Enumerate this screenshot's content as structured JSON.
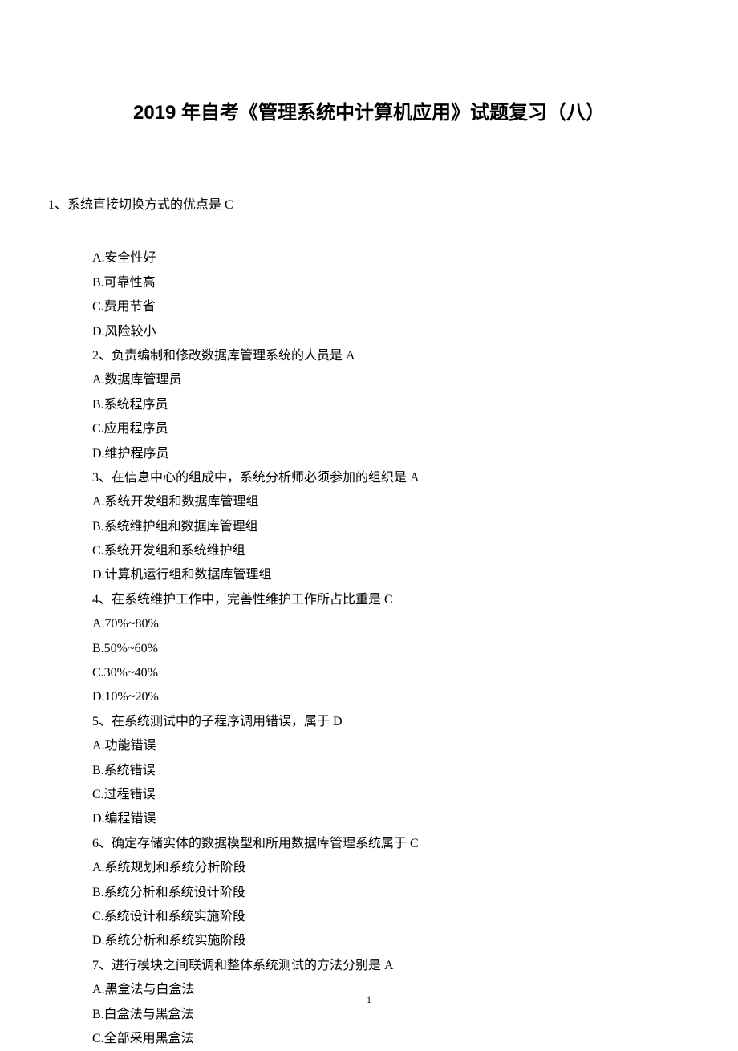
{
  "title": "2019 年自考《管理系统中计算机应用》试题复习（八）",
  "q1_stem": "1、系统直接切换方式的优点是 C",
  "lines": [
    "A.安全性好",
    "B.可靠性高",
    "C.费用节省",
    "D.风险较小",
    "2、负责编制和修改数据库管理系统的人员是 A",
    "A.数据库管理员",
    "B.系统程序员",
    "C.应用程序员",
    "D.维护程序员",
    "3、在信息中心的组成中，系统分析师必须参加的组织是 A",
    "A.系统开发组和数据库管理组",
    "B.系统维护组和数据库管理组",
    "C.系统开发组和系统维护组",
    "D.计算机运行组和数据库管理组",
    "4、在系统维护工作中，完善性维护工作所占比重是 C",
    "A.70%~80%",
    "B.50%~60%",
    "C.30%~40%",
    "D.10%~20%",
    "5、在系统测试中的子程序调用错误，属于 D",
    "A.功能错误",
    "B.系统错误",
    "C.过程错误",
    "D.编程错误",
    "6、确定存储实体的数据模型和所用数据库管理系统属于 C",
    "A.系统规划和系统分析阶段",
    "B.系统分析和系统设计阶段",
    "C.系统设计和系统实施阶段",
    "D.系统分析和系统实施阶段",
    "7、进行模块之间联调和整体系统测试的方法分别是 A",
    "A.黑盒法与白盒法",
    "B.白盒法与黑盒法",
    "C.全部采用黑盒法"
  ],
  "page_number": "1"
}
